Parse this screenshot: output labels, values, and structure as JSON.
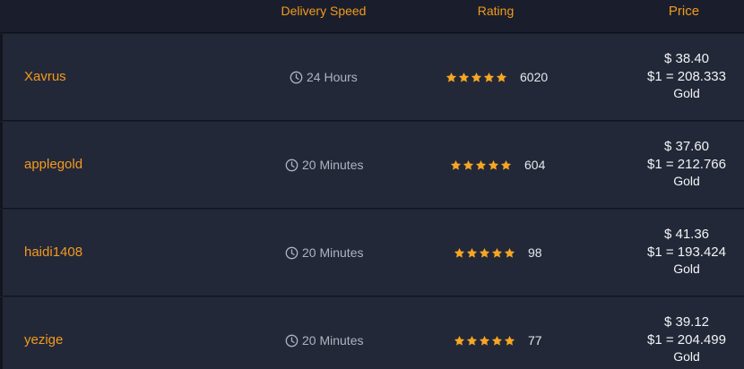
{
  "header": {
    "delivery_speed": "Delivery Speed",
    "rating": "Rating",
    "price": "Price"
  },
  "colors": {
    "accent": "#f39a1e",
    "row_bg": "#232838",
    "page_bg": "#1a1e2c",
    "star": "#f5a623"
  },
  "rows": [
    {
      "seller": "Xavrus",
      "delivery": "24 Hours",
      "stars": 5,
      "rating_count": "6020",
      "price": "$ 38.40",
      "rate": "$1 = 208.333",
      "unit": "Gold"
    },
    {
      "seller": "applegold",
      "delivery": "20 Minutes",
      "stars": 5,
      "rating_count": "604",
      "price": "$ 37.60",
      "rate": "$1 = 212.766",
      "unit": "Gold"
    },
    {
      "seller": "haidi1408",
      "delivery": "20 Minutes",
      "stars": 5,
      "rating_count": "98",
      "price": "$ 41.36",
      "rate": "$1 = 193.424",
      "unit": "Gold"
    },
    {
      "seller": "yezige",
      "delivery": "20 Minutes",
      "stars": 5,
      "rating_count": "77",
      "price": "$ 39.12",
      "rate": "$1 = 204.499",
      "unit": "Gold"
    }
  ]
}
